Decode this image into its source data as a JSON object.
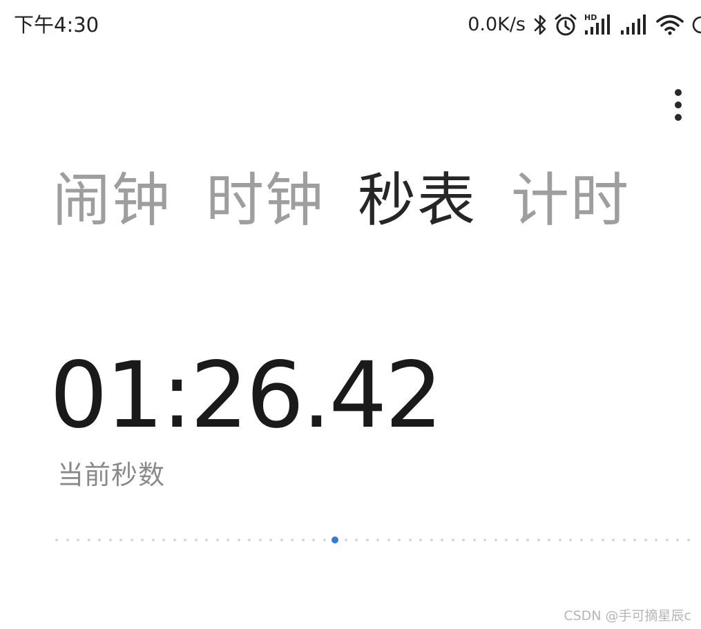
{
  "status_bar": {
    "time": "下午4:30",
    "net_speed": "0.0K/s",
    "icons": [
      "bluetooth-icon",
      "alarm-icon",
      "hd-signal-icon",
      "signal-icon",
      "wifi-icon",
      "battery-icon"
    ]
  },
  "toolbar": {
    "more_icon": "more-vert-icon"
  },
  "tabs": [
    {
      "label": "闹钟",
      "active": false
    },
    {
      "label": "时钟",
      "active": false
    },
    {
      "label": "秒表",
      "active": true
    },
    {
      "label": "计时",
      "active": false
    }
  ],
  "stopwatch": {
    "elapsed": "01:26.42",
    "caption": "当前秒数"
  },
  "second_indicator": {
    "total_dots": 60,
    "current_index": 26,
    "inactive_color": "#d6d6d6",
    "active_color": "#2d7be5"
  },
  "watermark": "CSDN @手可摘星辰c"
}
